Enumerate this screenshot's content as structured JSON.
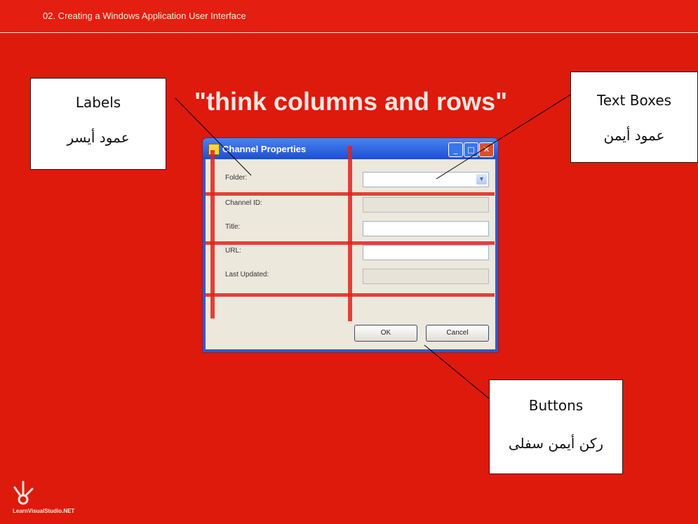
{
  "header": {
    "text": "02. Creating a Windows Application User Interface"
  },
  "title": "\"think columns and rows\"",
  "callouts": {
    "labels": {
      "en": "Labels",
      "ar": "عمود أيسر"
    },
    "textboxes": {
      "en": "Text Boxes",
      "ar": "عمود أيمن"
    },
    "buttons": {
      "en": "Buttons",
      "ar": "ركن أيمن سفلى"
    }
  },
  "dialog": {
    "title": "Channel Properties",
    "fields": [
      {
        "label": "Folder:",
        "value": ""
      },
      {
        "label": "Channel ID:",
        "value": ""
      },
      {
        "label": "Title:",
        "value": ""
      },
      {
        "label": "URL:",
        "value": ""
      },
      {
        "label": "Last Updated:",
        "value": ""
      }
    ],
    "ok_label": "OK",
    "cancel_label": "Cancel"
  },
  "logo": {
    "text": "LearnVisualStudio.NET"
  },
  "colors": {
    "background": "#dd1a0c",
    "dialog_title": "#1c4fd0",
    "dialog_body": "#ece8dc"
  }
}
